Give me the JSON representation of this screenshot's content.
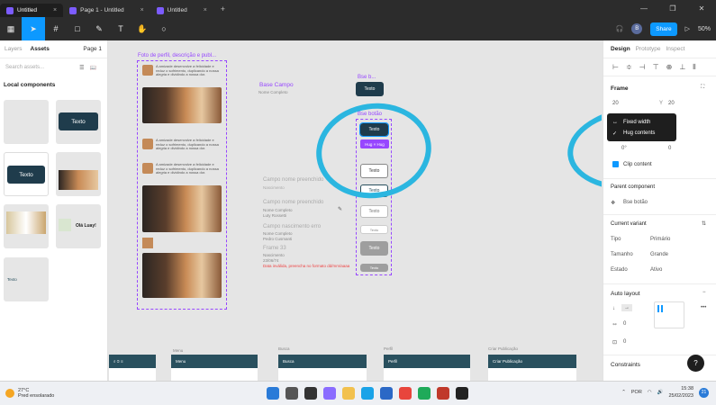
{
  "browser": {
    "tabs": [
      {
        "label": "Untitled",
        "active": true
      },
      {
        "label": "Page 1 - Untitled",
        "active": false
      },
      {
        "label": "Untitled",
        "active": false
      }
    ],
    "new_tab": "+",
    "controls": [
      "—",
      "❐",
      "✕"
    ]
  },
  "toolbar": {
    "share_label": "Share",
    "zoom": "50%",
    "avatar_initial": "B"
  },
  "left_panel": {
    "tabs": [
      "Layers",
      "Assets"
    ],
    "page": "Page 1",
    "search_placeholder": "Search assets...",
    "section": "Local components",
    "thumb_texts": [
      "Texto",
      "Texto",
      "Texto",
      "Olá Luay!"
    ]
  },
  "canvas": {
    "frame_labels": {
      "card": "Foto de perfil, descrição e publ...",
      "base_campo": "Base Campo",
      "base_campo_sub": "Nome Completo",
      "base_b": "Bse b...",
      "base_botao": "Bse botão"
    },
    "card_text": "A amizade desenvolve a felicidade e reduz o sofrimento, duplicando a nossa alegria e dividindo a nossa dor.",
    "buttons": {
      "texto": "Texto",
      "hug": "Hug × Hug"
    },
    "fields": [
      {
        "label": "Campo nome preenchido",
        "sub1": "Nascimento",
        "sub2": ""
      },
      {
        "label": "Campo nome preenchido",
        "sub1": "Nome Completo",
        "sub2": "Luty Rossetti"
      },
      {
        "label": "Campo nascimento erro",
        "sub1": "Nome Completo",
        "sub2": "Pedro Cusmanti"
      },
      {
        "label": "Frame 33",
        "sub1": "Nascimento",
        "sub2": "23/06/74"
      }
    ],
    "error_text": "Data inválida, preencha no formato dd/mm/aaaa",
    "bottom_frames": [
      {
        "title": "Menu",
        "header": "Menu"
      },
      {
        "title": "Busca",
        "header": "Busca"
      },
      {
        "title": "Perfil",
        "header": "Perfil"
      },
      {
        "title": "Criar Publicação",
        "header": "Criar Publicação"
      }
    ]
  },
  "right_panel": {
    "tabs": [
      "Design",
      "Prototype",
      "Inspect"
    ],
    "frame_label": "Frame",
    "x_value": "20",
    "y_value": "20",
    "w_value": "0°",
    "h_value": "0",
    "clip_content": "Clip content",
    "parent_component": "Parent component",
    "parent_name": "Bse botão",
    "current_variant": "Current variant",
    "variants": [
      {
        "prop": "Tipo",
        "value": "Primário"
      },
      {
        "prop": "Tamanho",
        "value": "Grande"
      },
      {
        "prop": "Estado",
        "value": "Ativo"
      }
    ],
    "auto_layout": "Auto layout",
    "spacing": "0",
    "padding": "0",
    "constraints": "Constraints",
    "popup": {
      "fixed": "Fixed width",
      "hug": "Hug contents"
    }
  },
  "taskbar": {
    "temp": "27°C",
    "weather": "Pred ensolarado",
    "lang": "POR",
    "time": "15:38",
    "date": "25/02/2023",
    "badge": "21"
  },
  "colors": {
    "accent": "#0d99ff",
    "component": "#9747ff",
    "button_dark": "#1f3c4c",
    "annotation": "#2bb6e0"
  }
}
